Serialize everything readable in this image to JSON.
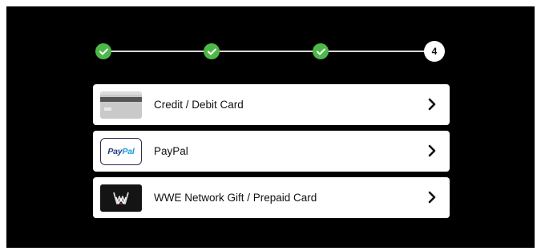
{
  "stepper": {
    "completed_steps": [
      1,
      2,
      3
    ],
    "current_step_label": "4",
    "colors": {
      "completed": "#4db848",
      "current": "#ffffff",
      "line": "#d8d8d8"
    }
  },
  "payment_options": [
    {
      "label": "Credit / Debit Card",
      "icon": "credit-card-icon"
    },
    {
      "label": "PayPal",
      "icon": "paypal-logo",
      "logo_text_a": "Pay",
      "logo_text_b": "Pal"
    },
    {
      "label": "WWE Network Gift / Prepaid Card",
      "icon": "wwe-logo"
    }
  ],
  "colors": {
    "background": "#000000",
    "card": "#ffffff",
    "text": "#111111"
  }
}
